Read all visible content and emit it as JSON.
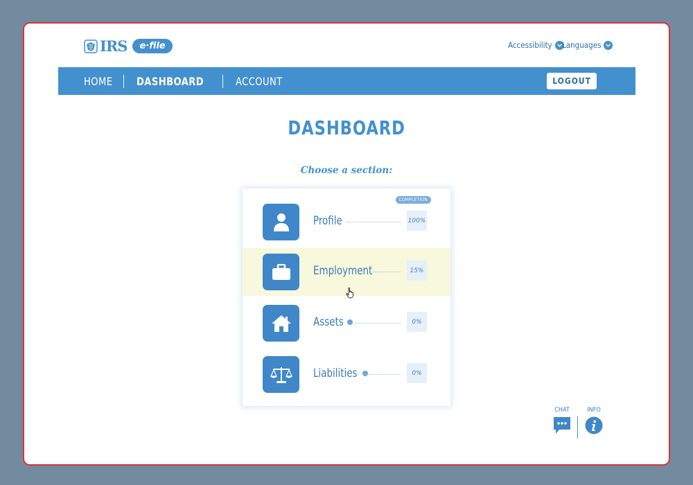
{
  "brand": {
    "logo_text": "IRS",
    "efile_text": "e·file",
    "primary": "#4390ce",
    "frame_border": "#d9343b"
  },
  "utility": {
    "accessibility": "Accessibility",
    "languages": "Languages"
  },
  "nav": {
    "home": "HOME",
    "dashboard": "DASHBOARD",
    "account": "ACCOUNT",
    "logout": "LOGOUT"
  },
  "page": {
    "title": "DASHBOARD",
    "subtitle": "Choose a section:"
  },
  "sections": {
    "completion_badge": "COMPLETION",
    "items": [
      {
        "label": "Profile",
        "percent": "100%",
        "icon": "person-icon",
        "help": false,
        "highlighted": false
      },
      {
        "label": "Employment",
        "percent": "15%",
        "icon": "briefcase-icon",
        "help": false,
        "highlighted": true
      },
      {
        "label": "Assets",
        "percent": "0%",
        "icon": "house-icon",
        "help": true,
        "highlighted": false
      },
      {
        "label": "Liabilities",
        "percent": "0%",
        "icon": "scales-icon",
        "help": true,
        "highlighted": false
      }
    ]
  },
  "footer": {
    "chat": "CHAT",
    "info": "INFO"
  }
}
